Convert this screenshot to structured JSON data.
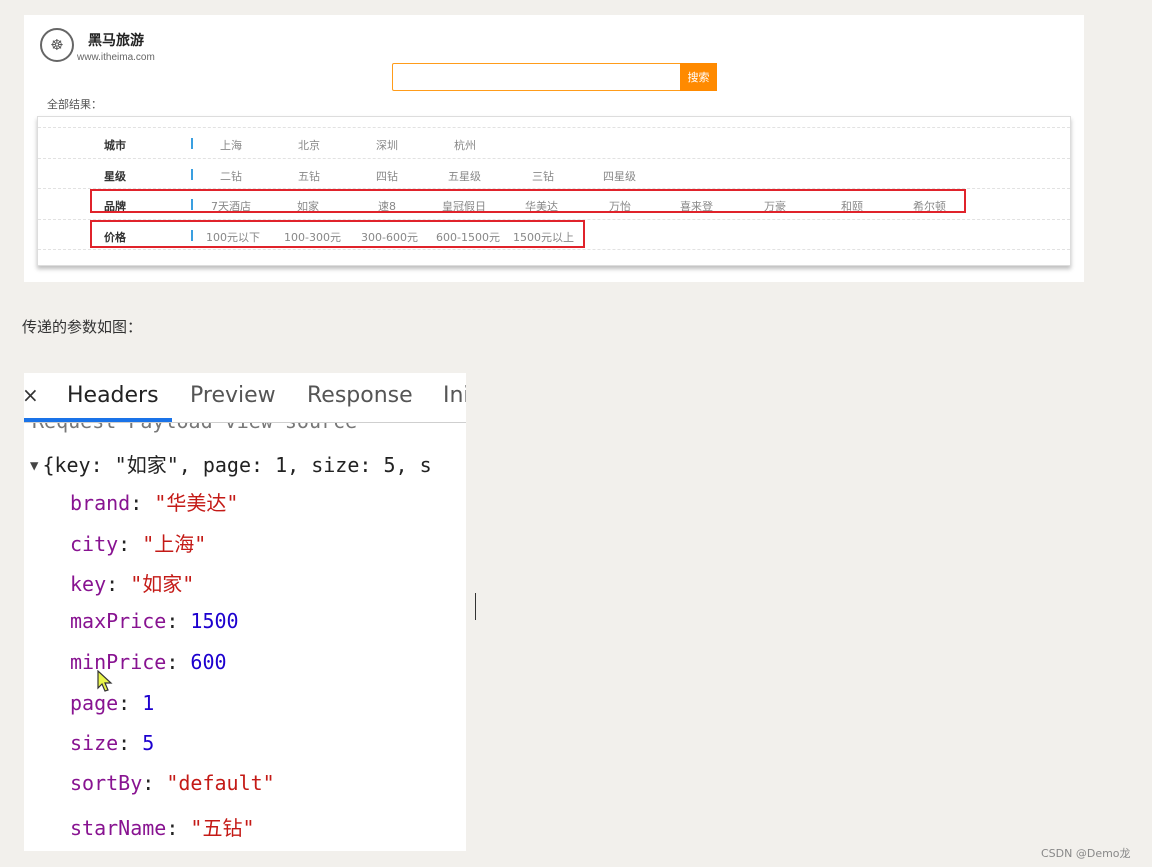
{
  "site": {
    "logo_glyph": "☸",
    "title": "黑马旅游",
    "url": "www.itheima.com",
    "search_placeholder": "",
    "search_button": "搜索",
    "all_results": "全部结果："
  },
  "filters": [
    {
      "label": "城市",
      "options": [
        "上海",
        "北京",
        "深圳",
        "杭州"
      ]
    },
    {
      "label": "星级",
      "options": [
        "二钻",
        "五钻",
        "四钻",
        "五星级",
        "三钻",
        "四星级"
      ]
    },
    {
      "label": "品牌",
      "options": [
        "7天酒店",
        "如家",
        "速8",
        "皇冠假日",
        "华美达",
        "万怡",
        "喜来登",
        "万豪",
        "和颐",
        "希尔顿"
      ]
    },
    {
      "label": "价格",
      "options": [
        "100元以下",
        "100-300元",
        "300-600元",
        "600-1500元",
        "1500元以上"
      ]
    }
  ],
  "caption": "传递的参数如图：",
  "devtools": {
    "close_glyph": "×",
    "tabs": [
      "Headers",
      "Preview",
      "Response",
      "Ini"
    ],
    "active_tab": "Headers",
    "cut_off_text": "Request Payload      view source",
    "summary": "{key: \"如家\", page: 1, size: 5, s",
    "properties": [
      {
        "key": "brand",
        "value": "\"华美达\"",
        "type": "string"
      },
      {
        "key": "city",
        "value": "\"上海\"",
        "type": "string"
      },
      {
        "key": "key",
        "value": "\"如家\"",
        "type": "string"
      },
      {
        "key": "maxPrice",
        "value": "1500",
        "type": "number"
      },
      {
        "key": "minPrice",
        "value": "600",
        "type": "number"
      },
      {
        "key": "page",
        "value": "1",
        "type": "number"
      },
      {
        "key": "size",
        "value": "5",
        "type": "number"
      },
      {
        "key": "sortBy",
        "value": "\"default\"",
        "type": "string"
      },
      {
        "key": "starName",
        "value": "\"五钻\"",
        "type": "string"
      }
    ]
  },
  "watermark": "CSDN @Demo龙"
}
